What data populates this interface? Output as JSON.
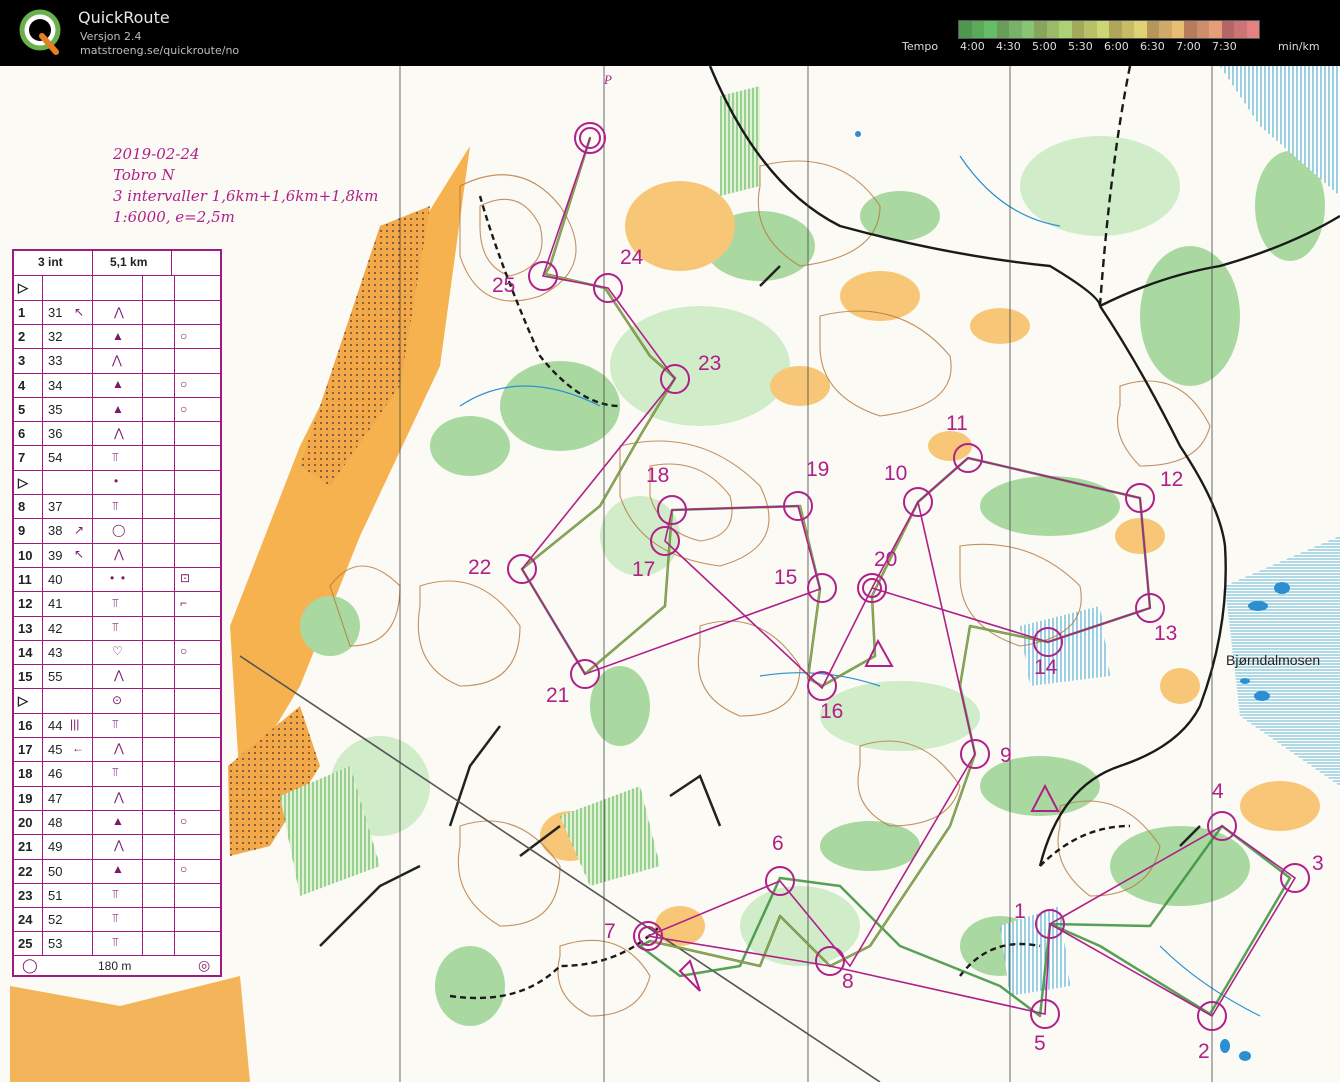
{
  "app": {
    "title": "QuickRoute",
    "version": "Versjon 2.4",
    "url": "matstroeng.se/quickroute/no"
  },
  "tempo": {
    "label": "Tempo",
    "unit": "min/km",
    "ticks": [
      "4:00",
      "4:30",
      "5:00",
      "5:30",
      "6:00",
      "6:30",
      "7:00",
      "7:30"
    ],
    "colors": [
      "#6ac86a",
      "#8ed07a",
      "#b6dc7c",
      "#d8e27a",
      "#eadd78",
      "#f3c87a",
      "#f2a67e",
      "#f0888a"
    ]
  },
  "map": {
    "header_lines": [
      "2019-02-24",
      "Tobro N",
      "3 intervaller 1,6km+1,6km+1,8km",
      "1:6000, e=2,5m"
    ],
    "place_name": "Bjørndalmosen",
    "parking_label": "P",
    "accent": "#b0208a"
  },
  "description_sheet": {
    "event": "3 int",
    "length": "5,1 km",
    "marked_route": "180 m",
    "rows": [
      {
        "num": "▷",
        "code": ""
      },
      {
        "num": "1",
        "code": "31"
      },
      {
        "num": "2",
        "code": "32"
      },
      {
        "num": "3",
        "code": "33"
      },
      {
        "num": "4",
        "code": "34"
      },
      {
        "num": "5",
        "code": "35"
      },
      {
        "num": "6",
        "code": "36"
      },
      {
        "num": "7",
        "code": "54"
      },
      {
        "num": "▷",
        "code": ""
      },
      {
        "num": "8",
        "code": "37"
      },
      {
        "num": "9",
        "code": "38"
      },
      {
        "num": "10",
        "code": "39"
      },
      {
        "num": "11",
        "code": "40"
      },
      {
        "num": "12",
        "code": "41"
      },
      {
        "num": "13",
        "code": "42"
      },
      {
        "num": "14",
        "code": "43"
      },
      {
        "num": "15",
        "code": "55"
      },
      {
        "num": "▷",
        "code": ""
      },
      {
        "num": "16",
        "code": "44"
      },
      {
        "num": "17",
        "code": "45"
      },
      {
        "num": "18",
        "code": "46"
      },
      {
        "num": "19",
        "code": "47"
      },
      {
        "num": "20",
        "code": "48"
      },
      {
        "num": "21",
        "code": "49"
      },
      {
        "num": "22",
        "code": "50"
      },
      {
        "num": "23",
        "code": "51"
      },
      {
        "num": "24",
        "code": "52"
      },
      {
        "num": "25",
        "code": "53"
      }
    ]
  },
  "controls": {
    "labels": [
      "1",
      "2",
      "3",
      "4",
      "5",
      "6",
      "7",
      "8",
      "9",
      "10",
      "11",
      "12",
      "13",
      "14",
      "15",
      "16",
      "17",
      "18",
      "19",
      "20",
      "21",
      "22",
      "23",
      "24",
      "25"
    ]
  }
}
